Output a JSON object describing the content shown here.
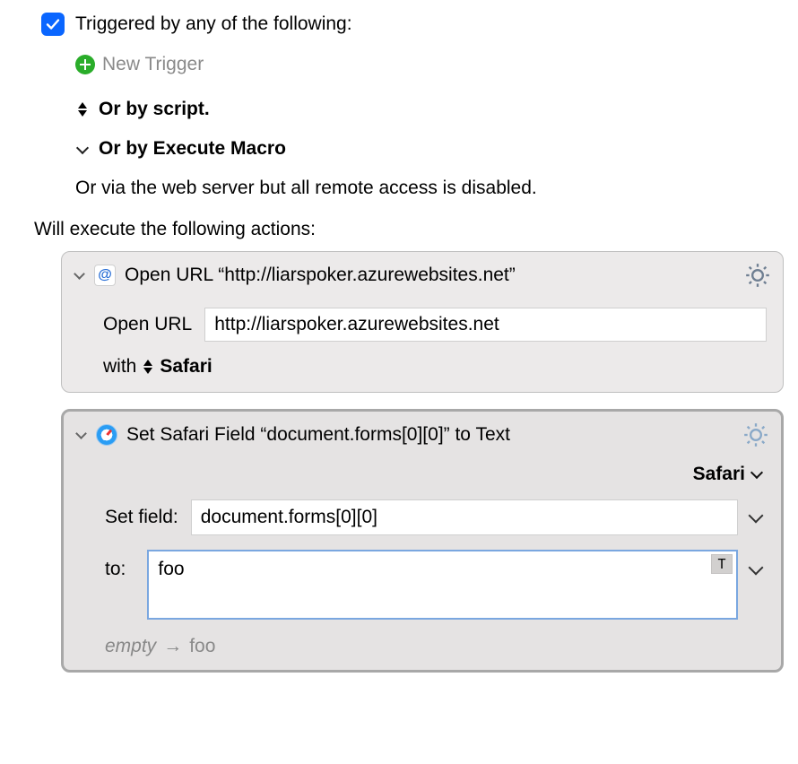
{
  "trigger": {
    "checked": true,
    "label": "Triggered by any of the following:",
    "new_trigger_label": "New Trigger",
    "or_script_label": "Or by script.",
    "or_execute_macro_label": "Or by Execute Macro",
    "web_server_label": "Or via the web server but all remote access is disabled."
  },
  "actions_header": "Will execute the following actions:",
  "actions": {
    "open_url": {
      "title": "Open URL “http://liarspoker.azurewebsites.net”",
      "open_url_label": "Open URL",
      "url_value": "http://liarspoker.azurewebsites.net",
      "with_label": "with",
      "browser": "Safari"
    },
    "set_field": {
      "title": "Set Safari Field “document.forms[0][0]” to Text",
      "browser_dropdown": "Safari",
      "set_field_label": "Set field:",
      "field_path": "document.forms[0][0]",
      "to_label": "to:",
      "to_value": "foo",
      "token_badge": "T",
      "result_prev": "empty",
      "result_arrow": "→",
      "result_new": "foo"
    }
  }
}
